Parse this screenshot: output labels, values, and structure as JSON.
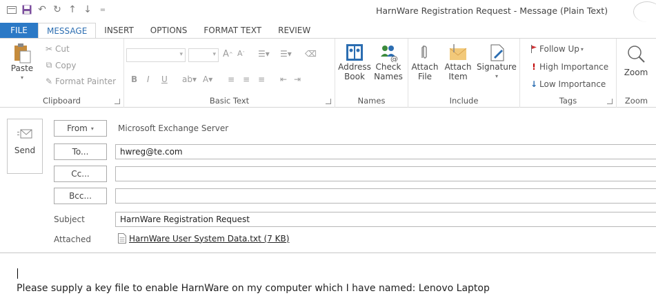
{
  "window": {
    "title": "HarnWare Registration Request - Message (Plain Text)",
    "qat_icons": [
      "envelope-icon",
      "save-icon",
      "undo-icon",
      "redo-icon",
      "up-arrow-icon",
      "down-arrow-icon",
      "customize-icon"
    ]
  },
  "tabs": [
    "FILE",
    "MESSAGE",
    "INSERT",
    "OPTIONS",
    "FORMAT TEXT",
    "REVIEW"
  ],
  "ribbon": {
    "clipboard": {
      "label": "Clipboard",
      "paste": "Paste",
      "cut": "Cut",
      "copy": "Copy",
      "format_painter": "Format Painter"
    },
    "basic_text": {
      "label": "Basic Text"
    },
    "names": {
      "label": "Names",
      "address_book_1": "Address",
      "address_book_2": "Book",
      "check_names_1": "Check",
      "check_names_2": "Names"
    },
    "include": {
      "label": "Include",
      "attach_file_1": "Attach",
      "attach_file_2": "File",
      "attach_item_1": "Attach",
      "attach_item_2": "Item",
      "signature": "Signature"
    },
    "tags": {
      "label": "Tags",
      "follow_up": "Follow Up",
      "high": "High Importance",
      "low": "Low Importance"
    },
    "zoom": {
      "label": "Zoom",
      "button": "Zoom"
    }
  },
  "header": {
    "send": "Send",
    "from_btn": "From",
    "from_value": "Microsoft Exchange Server",
    "to_btn": "To...",
    "to_value": "hwreg@te.com",
    "cc_btn": "Cc...",
    "cc_value": "",
    "bcc_btn": "Bcc...",
    "bcc_value": "",
    "subject_label": "Subject",
    "subject_value": "HarnWare Registration Request",
    "attached_label": "Attached",
    "attachment": "HarnWare User System Data.txt (7 KB)"
  },
  "body": {
    "text": "Please supply a key file to enable HarnWare on my computer which I have named: Lenovo Laptop"
  },
  "colors": {
    "file_tab": "#2b79c6",
    "accent": "#2b6db1",
    "flag": "#d13438",
    "high_importance": "#c00000",
    "low_importance": "#2b6db1"
  }
}
